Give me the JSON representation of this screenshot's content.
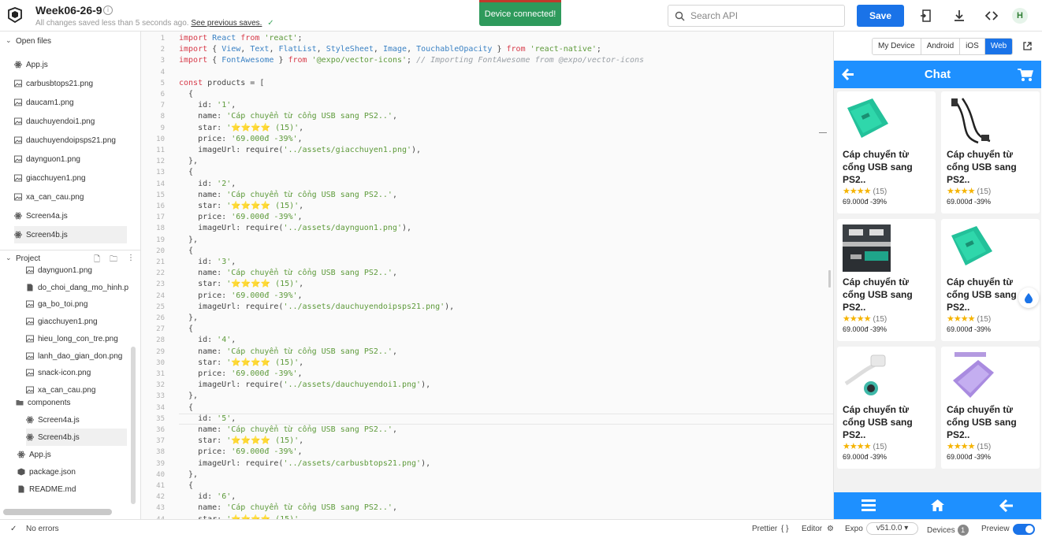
{
  "header": {
    "title": "Week06-26-9",
    "save_status": "All changes saved less than 5 seconds ago.",
    "previous_saves_link": "See previous saves.",
    "toast": "Device connected!",
    "search_placeholder": "Search API",
    "save_label": "Save",
    "avatar_initial": "H"
  },
  "sidebar": {
    "open_files_label": "Open files",
    "open_files": [
      "App.js",
      "carbusbtops21.png",
      "daucam1.png",
      "dauchuyendoi1.png",
      "dauchuyendoipsps21.png",
      "daynguon1.png",
      "giacchuyen1.png",
      "xa_can_cau.png",
      "Screen4a.js",
      "Screen4b.js"
    ],
    "project_label": "Project",
    "project_assets": [
      "daynguon1.png",
      "do_choi_dang_mo_hinh.p",
      "ga_bo_toi.png",
      "giacchuyen1.png",
      "hieu_long_con_tre.png",
      "lanh_dao_gian_don.png",
      "snack-icon.png",
      "xa_can_cau.png"
    ],
    "components_folder": "components",
    "component_files": [
      "Screen4a.js",
      "Screen4b.js"
    ],
    "root_files": [
      "App.js",
      "package.json",
      "README.md"
    ]
  },
  "editor": {
    "lines": [
      [
        [
          "kw",
          "import "
        ],
        [
          "ident",
          "React"
        ],
        [
          "kw",
          " from "
        ],
        [
          "str",
          "'react'"
        ],
        [
          "plain",
          ";"
        ]
      ],
      [
        [
          "kw",
          "import "
        ],
        [
          "plain",
          "{ "
        ],
        [
          "ident",
          "View"
        ],
        [
          "plain",
          ", "
        ],
        [
          "ident",
          "Text"
        ],
        [
          "plain",
          ", "
        ],
        [
          "ident",
          "FlatList"
        ],
        [
          "plain",
          ", "
        ],
        [
          "ident",
          "StyleSheet"
        ],
        [
          "plain",
          ", "
        ],
        [
          "ident",
          "Image"
        ],
        [
          "plain",
          ", "
        ],
        [
          "ident",
          "TouchableOpacity"
        ],
        [
          "plain",
          " } "
        ],
        [
          "kw",
          "from "
        ],
        [
          "str",
          "'react-native'"
        ],
        [
          "plain",
          ";"
        ]
      ],
      [
        [
          "kw",
          "import "
        ],
        [
          "plain",
          "{ "
        ],
        [
          "ident",
          "FontAwesome"
        ],
        [
          "plain",
          " } "
        ],
        [
          "kw",
          "from "
        ],
        [
          "str",
          "'@expo/vector-icons'"
        ],
        [
          "plain",
          "; "
        ],
        [
          "cm",
          "// Importing FontAwesome from @expo/vector-icons"
        ]
      ],
      [],
      [
        [
          "kw",
          "const "
        ],
        [
          "plain",
          "products = ["
        ]
      ],
      [
        [
          "plain",
          "  {"
        ]
      ],
      [
        [
          "plain",
          "    id: "
        ],
        [
          "str",
          "'1'"
        ],
        [
          "plain",
          ","
        ]
      ],
      [
        [
          "plain",
          "    name: "
        ],
        [
          "str",
          "'Cáp chuyển từ cổng USB sang PS2..'"
        ],
        [
          "plain",
          ","
        ]
      ],
      [
        [
          "plain",
          "    star: "
        ],
        [
          "str",
          "'⭐⭐⭐⭐ (15)'"
        ],
        [
          "plain",
          ","
        ]
      ],
      [
        [
          "plain",
          "    price: "
        ],
        [
          "str",
          "'69.000đ -39%'"
        ],
        [
          "plain",
          ","
        ]
      ],
      [
        [
          "plain",
          "    imageUrl: require("
        ],
        [
          "str",
          "'../assets/giacchuyen1.png'"
        ],
        [
          "plain",
          "),"
        ]
      ],
      [
        [
          "plain",
          "  },"
        ]
      ],
      [
        [
          "plain",
          "  {"
        ]
      ],
      [
        [
          "plain",
          "    id: "
        ],
        [
          "str",
          "'2'"
        ],
        [
          "plain",
          ","
        ]
      ],
      [
        [
          "plain",
          "    name: "
        ],
        [
          "str",
          "'Cáp chuyển từ cổng USB sang PS2..'"
        ],
        [
          "plain",
          ","
        ]
      ],
      [
        [
          "plain",
          "    star: "
        ],
        [
          "str",
          "'⭐⭐⭐⭐ (15)'"
        ],
        [
          "plain",
          ","
        ]
      ],
      [
        [
          "plain",
          "    price: "
        ],
        [
          "str",
          "'69.000đ -39%'"
        ],
        [
          "plain",
          ","
        ]
      ],
      [
        [
          "plain",
          "    imageUrl: require("
        ],
        [
          "str",
          "'../assets/daynguon1.png'"
        ],
        [
          "plain",
          "),"
        ]
      ],
      [
        [
          "plain",
          "  },"
        ]
      ],
      [
        [
          "plain",
          "  {"
        ]
      ],
      [
        [
          "plain",
          "    id: "
        ],
        [
          "str",
          "'3'"
        ],
        [
          "plain",
          ","
        ]
      ],
      [
        [
          "plain",
          "    name: "
        ],
        [
          "str",
          "'Cáp chuyển từ cổng USB sang PS2..'"
        ],
        [
          "plain",
          ","
        ]
      ],
      [
        [
          "plain",
          "    star: "
        ],
        [
          "str",
          "'⭐⭐⭐⭐ (15)'"
        ],
        [
          "plain",
          ","
        ]
      ],
      [
        [
          "plain",
          "    price: "
        ],
        [
          "str",
          "'69.000đ -39%'"
        ],
        [
          "plain",
          ","
        ]
      ],
      [
        [
          "plain",
          "    imageUrl: require("
        ],
        [
          "str",
          "'../assets/dauchuyendoipsps21.png'"
        ],
        [
          "plain",
          "),"
        ]
      ],
      [
        [
          "plain",
          "  },"
        ]
      ],
      [
        [
          "plain",
          "  {"
        ]
      ],
      [
        [
          "plain",
          "    id: "
        ],
        [
          "str",
          "'4'"
        ],
        [
          "plain",
          ","
        ]
      ],
      [
        [
          "plain",
          "    name: "
        ],
        [
          "str",
          "'Cáp chuyển từ cổng USB sang PS2..'"
        ],
        [
          "plain",
          ","
        ]
      ],
      [
        [
          "plain",
          "    star: "
        ],
        [
          "str",
          "'⭐⭐⭐⭐ (15)'"
        ],
        [
          "plain",
          ","
        ]
      ],
      [
        [
          "plain",
          "    price: "
        ],
        [
          "str",
          "'69.000đ -39%'"
        ],
        [
          "plain",
          ","
        ]
      ],
      [
        [
          "plain",
          "    imageUrl: require("
        ],
        [
          "str",
          "'../assets/dauchuyendoi1.png'"
        ],
        [
          "plain",
          "),"
        ]
      ],
      [
        [
          "plain",
          "  },"
        ]
      ],
      [
        [
          "plain",
          "  {"
        ]
      ],
      [
        [
          "plain",
          "    id: "
        ],
        [
          "str",
          "'5'"
        ],
        [
          "plain",
          ","
        ]
      ],
      [
        [
          "plain",
          "    name: "
        ],
        [
          "str",
          "'Cáp chuyển từ cổng USB sang PS2..'"
        ],
        [
          "plain",
          ","
        ]
      ],
      [
        [
          "plain",
          "    star: "
        ],
        [
          "str",
          "'⭐⭐⭐⭐ (15)'"
        ],
        [
          "plain",
          ","
        ]
      ],
      [
        [
          "plain",
          "    price: "
        ],
        [
          "str",
          "'69.000đ -39%'"
        ],
        [
          "plain",
          ","
        ]
      ],
      [
        [
          "plain",
          "    imageUrl: require("
        ],
        [
          "str",
          "'../assets/carbusbtops21.png'"
        ],
        [
          "plain",
          "),"
        ]
      ],
      [
        [
          "plain",
          "  },"
        ]
      ],
      [
        [
          "plain",
          "  {"
        ]
      ],
      [
        [
          "plain",
          "    id: "
        ],
        [
          "str",
          "'6'"
        ],
        [
          "plain",
          ","
        ]
      ],
      [
        [
          "plain",
          "    name: "
        ],
        [
          "str",
          "'Cáp chuyển từ cổng USB sang PS2..'"
        ],
        [
          "plain",
          ","
        ]
      ],
      [
        [
          "plain",
          "    star: "
        ],
        [
          "str",
          "'⭐⭐⭐⭐ (15)'"
        ],
        [
          "plain",
          ","
        ]
      ]
    ],
    "active_line": 35
  },
  "preview": {
    "tabs": [
      "My Device",
      "Android",
      "iOS",
      "Web"
    ],
    "active_tab": "Web",
    "app_title": "Chat",
    "products": [
      {
        "name": "Cáp chuyển từ cổng USB sang PS2..",
        "stars": "★★★★",
        "count": "(15)",
        "price": "69.000đ -39%",
        "image": "green-adapter"
      },
      {
        "name": "Cáp chuyển từ cổng USB sang PS2..",
        "stars": "★★★★",
        "count": "(15)",
        "price": "69.000đ -39%",
        "image": "black-cable"
      },
      {
        "name": "Cáp chuyển từ cổng USB sang PS2..",
        "stars": "★★★★",
        "count": "(15)",
        "price": "69.000đ -39%",
        "image": "usb-ports"
      },
      {
        "name": "Cáp chuyển từ cổng USB sang PS2..",
        "stars": "★★★★",
        "count": "(15)",
        "price": "69.000đ -39%",
        "image": "green-adapter"
      },
      {
        "name": "Cáp chuyển từ cổng USB sang PS2..",
        "stars": "★★★★",
        "count": "(15)",
        "price": "69.000đ -39%",
        "image": "white-cable"
      },
      {
        "name": "Cáp chuyển từ cổng USB sang PS2..",
        "stars": "★★★★",
        "count": "(15)",
        "price": "69.000đ -39%",
        "image": "purple-adapter"
      }
    ]
  },
  "statusbar": {
    "errors": "No errors",
    "prettier": "Prettier",
    "editor": "Editor",
    "expo": "Expo",
    "version": "v51.0.0 ▾",
    "devices": "Devices",
    "devices_count": "1",
    "preview": "Preview"
  },
  "colors": {
    "accent": "#1a73e8",
    "app_header": "#1e90ff",
    "toast": "#2e9a5c",
    "keyword": "#d73a49",
    "string": "#5d9a3a"
  }
}
